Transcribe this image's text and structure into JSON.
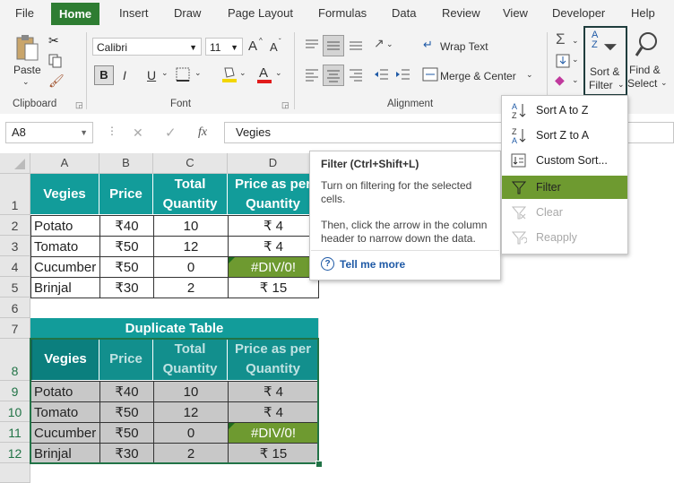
{
  "menu": {
    "tabs": [
      "File",
      "Home",
      "Insert",
      "Draw",
      "Page Layout",
      "Formulas",
      "Data",
      "Review",
      "View",
      "Developer",
      "Help"
    ],
    "active": "Home"
  },
  "ribbon": {
    "clipboard": {
      "label": "Clipboard",
      "paste": "Paste"
    },
    "font": {
      "label": "Font",
      "name": "Calibri",
      "size": "11",
      "bold": "B",
      "italic": "I",
      "underline": "U",
      "grow": "A",
      "shrink": "A"
    },
    "alignment": {
      "label": "Alignment",
      "wrap_text": "Wrap Text",
      "merge_center": "Merge & Center"
    },
    "editing": {
      "sort_filter": "Sort &",
      "sort_filter2": "Filter",
      "find_select": "Find &",
      "find_select2": "Select"
    }
  },
  "formula_bar": {
    "name_box": "A8",
    "fx": "fx",
    "value": "Vegies"
  },
  "columns": [
    "A",
    "B",
    "C",
    "D"
  ],
  "rows": [
    "1",
    "2",
    "3",
    "4",
    "5",
    "6",
    "7",
    "8",
    "9",
    "10",
    "11",
    "12"
  ],
  "table1": {
    "headers": [
      "Vegies",
      "Price",
      "Total Quantity",
      "Price as per Quantity"
    ],
    "rows": [
      [
        "Potato",
        "₹40",
        "10",
        "₹ 4"
      ],
      [
        "Tomato",
        "₹50",
        "12",
        "₹ 4"
      ],
      [
        "Cucumber",
        "₹50",
        "0",
        "#DIV/0!"
      ],
      [
        "Brinjal",
        "₹30",
        "2",
        "₹ 15"
      ]
    ]
  },
  "table2": {
    "title": "Duplicate Table",
    "headers": [
      "Vegies",
      "Price",
      "Total Quantity",
      "Price as per Quantity"
    ],
    "rows": [
      [
        "Potato",
        "₹40",
        "10",
        "₹ 4"
      ],
      [
        "Tomato",
        "₹50",
        "12",
        "₹ 4"
      ],
      [
        "Cucumber",
        "₹50",
        "0",
        "#DIV/0!"
      ],
      [
        "Brinjal",
        "₹30",
        "2",
        "₹ 15"
      ]
    ]
  },
  "tooltip": {
    "title": "Filter (Ctrl+Shift+L)",
    "line1": "Turn on filtering for the selected cells.",
    "line2": "Then, click the arrow in the column header to narrow down the data.",
    "more": "Tell me more"
  },
  "dropdown": {
    "items": [
      {
        "label": "Sort A to Z",
        "icon": "sort-asc-icon"
      },
      {
        "label": "Sort Z to A",
        "icon": "sort-desc-icon"
      },
      {
        "label": "Custom Sort...",
        "icon": "custom-sort-icon"
      },
      {
        "label": "Filter",
        "icon": "filter-icon"
      },
      {
        "label": "Clear",
        "icon": "clear-filter-icon"
      },
      {
        "label": "Reapply",
        "icon": "reapply-icon"
      }
    ]
  },
  "colors": {
    "accent": "#2e7d32",
    "teal": "#129c9a",
    "error_fill": "#6e9a30"
  }
}
